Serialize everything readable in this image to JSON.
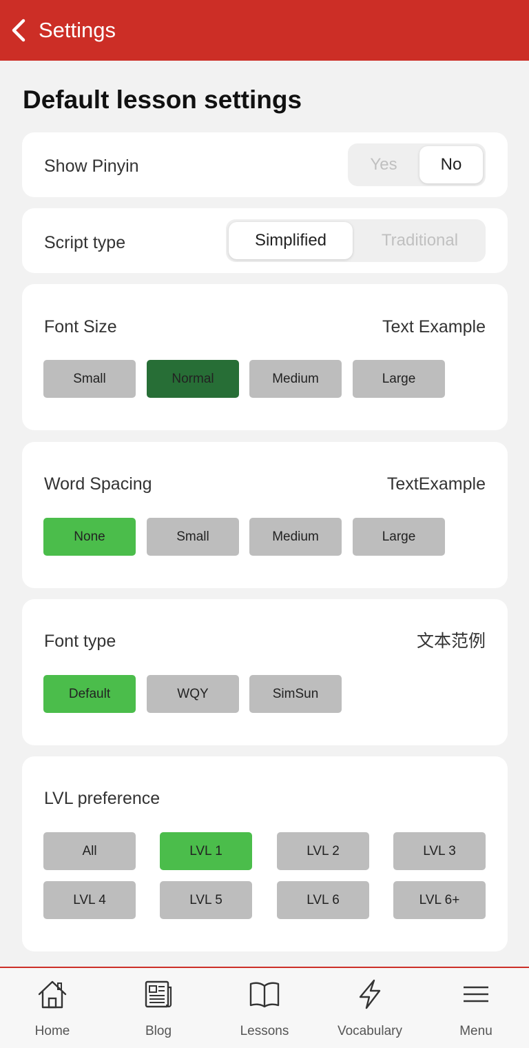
{
  "header": {
    "title": "Settings"
  },
  "page_title": "Default lesson settings",
  "show_pinyin": {
    "label": "Show Pinyin",
    "options": [
      "Yes",
      "No"
    ],
    "selected": "No"
  },
  "script_type": {
    "label": "Script type",
    "options": [
      "Simplified",
      "Traditional"
    ],
    "selected": "Simplified"
  },
  "font_size": {
    "label": "Font Size",
    "example": "Text Example",
    "options": [
      "Small",
      "Normal",
      "Medium",
      "Large"
    ],
    "selected": "Normal"
  },
  "word_spacing": {
    "label": "Word Spacing",
    "example": "TextExample",
    "options": [
      "None",
      "Small",
      "Medium",
      "Large"
    ],
    "selected": "None"
  },
  "font_type": {
    "label": "Font type",
    "example": "文本范例",
    "options": [
      "Default",
      "WQY",
      "SimSun"
    ],
    "selected": "Default"
  },
  "lvl_preference": {
    "label": "LVL preference",
    "options": [
      "All",
      "LVL 1",
      "LVL 2",
      "LVL 3",
      "LVL 4",
      "LVL 5",
      "LVL 6",
      "LVL 6+"
    ],
    "selected": "LVL 1"
  },
  "tabbar": {
    "items": [
      {
        "label": "Home",
        "icon": "home-icon"
      },
      {
        "label": "Blog",
        "icon": "newspaper-icon"
      },
      {
        "label": "Lessons",
        "icon": "book-icon"
      },
      {
        "label": "Vocabulary",
        "icon": "lightning-icon"
      },
      {
        "label": "Menu",
        "icon": "menu-icon"
      }
    ]
  },
  "colors": {
    "header": "#cc2e26",
    "selected_green": "#4bbd4b",
    "selected_dark_green": "#276e36",
    "chip_gray": "#bdbdbd"
  }
}
